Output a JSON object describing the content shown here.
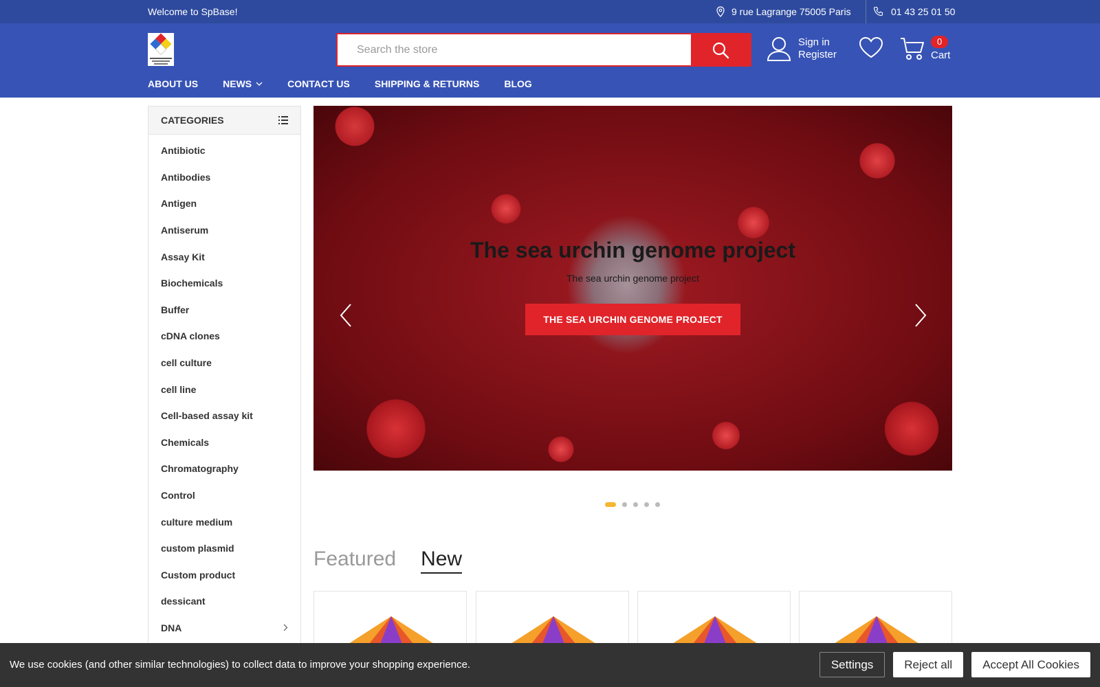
{
  "topbar": {
    "welcome": "Welcome to SpBase!",
    "address": "9 rue Lagrange 75005 Paris",
    "phone": "01 43 25 01 50"
  },
  "header": {
    "search_placeholder": "Search the store",
    "sign_in": "Sign in",
    "register": "Register",
    "cart_count": "0",
    "cart_label": "Cart"
  },
  "nav": {
    "items": [
      {
        "label": "About Us"
      },
      {
        "label": "News"
      },
      {
        "label": "Contact Us"
      },
      {
        "label": "Shipping & Returns"
      },
      {
        "label": "Blog"
      }
    ]
  },
  "sidebar": {
    "title": "CATEGORIES",
    "items": [
      {
        "label": "Antibiotic"
      },
      {
        "label": "Antibodies"
      },
      {
        "label": "Antigen"
      },
      {
        "label": "Antiserum"
      },
      {
        "label": "Assay Kit"
      },
      {
        "label": "Biochemicals"
      },
      {
        "label": "Buffer"
      },
      {
        "label": "cDNA clones"
      },
      {
        "label": "cell culture"
      },
      {
        "label": "cell line"
      },
      {
        "label": "Cell-based assay kit"
      },
      {
        "label": "Chemicals"
      },
      {
        "label": "Chromatography"
      },
      {
        "label": "Control"
      },
      {
        "label": "culture medium"
      },
      {
        "label": "custom plasmid"
      },
      {
        "label": "Custom product"
      },
      {
        "label": "dessicant"
      },
      {
        "label": "DNA"
      }
    ]
  },
  "slider": {
    "title": "The sea urchin genome project",
    "subtitle": "The sea urchin genome project",
    "cta": "THE SEA URCHIN GENOME PROJECT",
    "slide_count": 5,
    "active_slide": 1
  },
  "tabs": {
    "featured": "Featured",
    "new": "New",
    "active": "New"
  },
  "cookie": {
    "message": "We use cookies (and other similar technologies) to collect data to improve your shopping experience.",
    "settings": "Settings",
    "reject": "Reject all",
    "accept": "Accept All Cookies"
  },
  "colors": {
    "primary": "#3753b5",
    "topbar": "#2e4a9e",
    "accent": "#e0242a",
    "dot_active": "#f5b731"
  }
}
